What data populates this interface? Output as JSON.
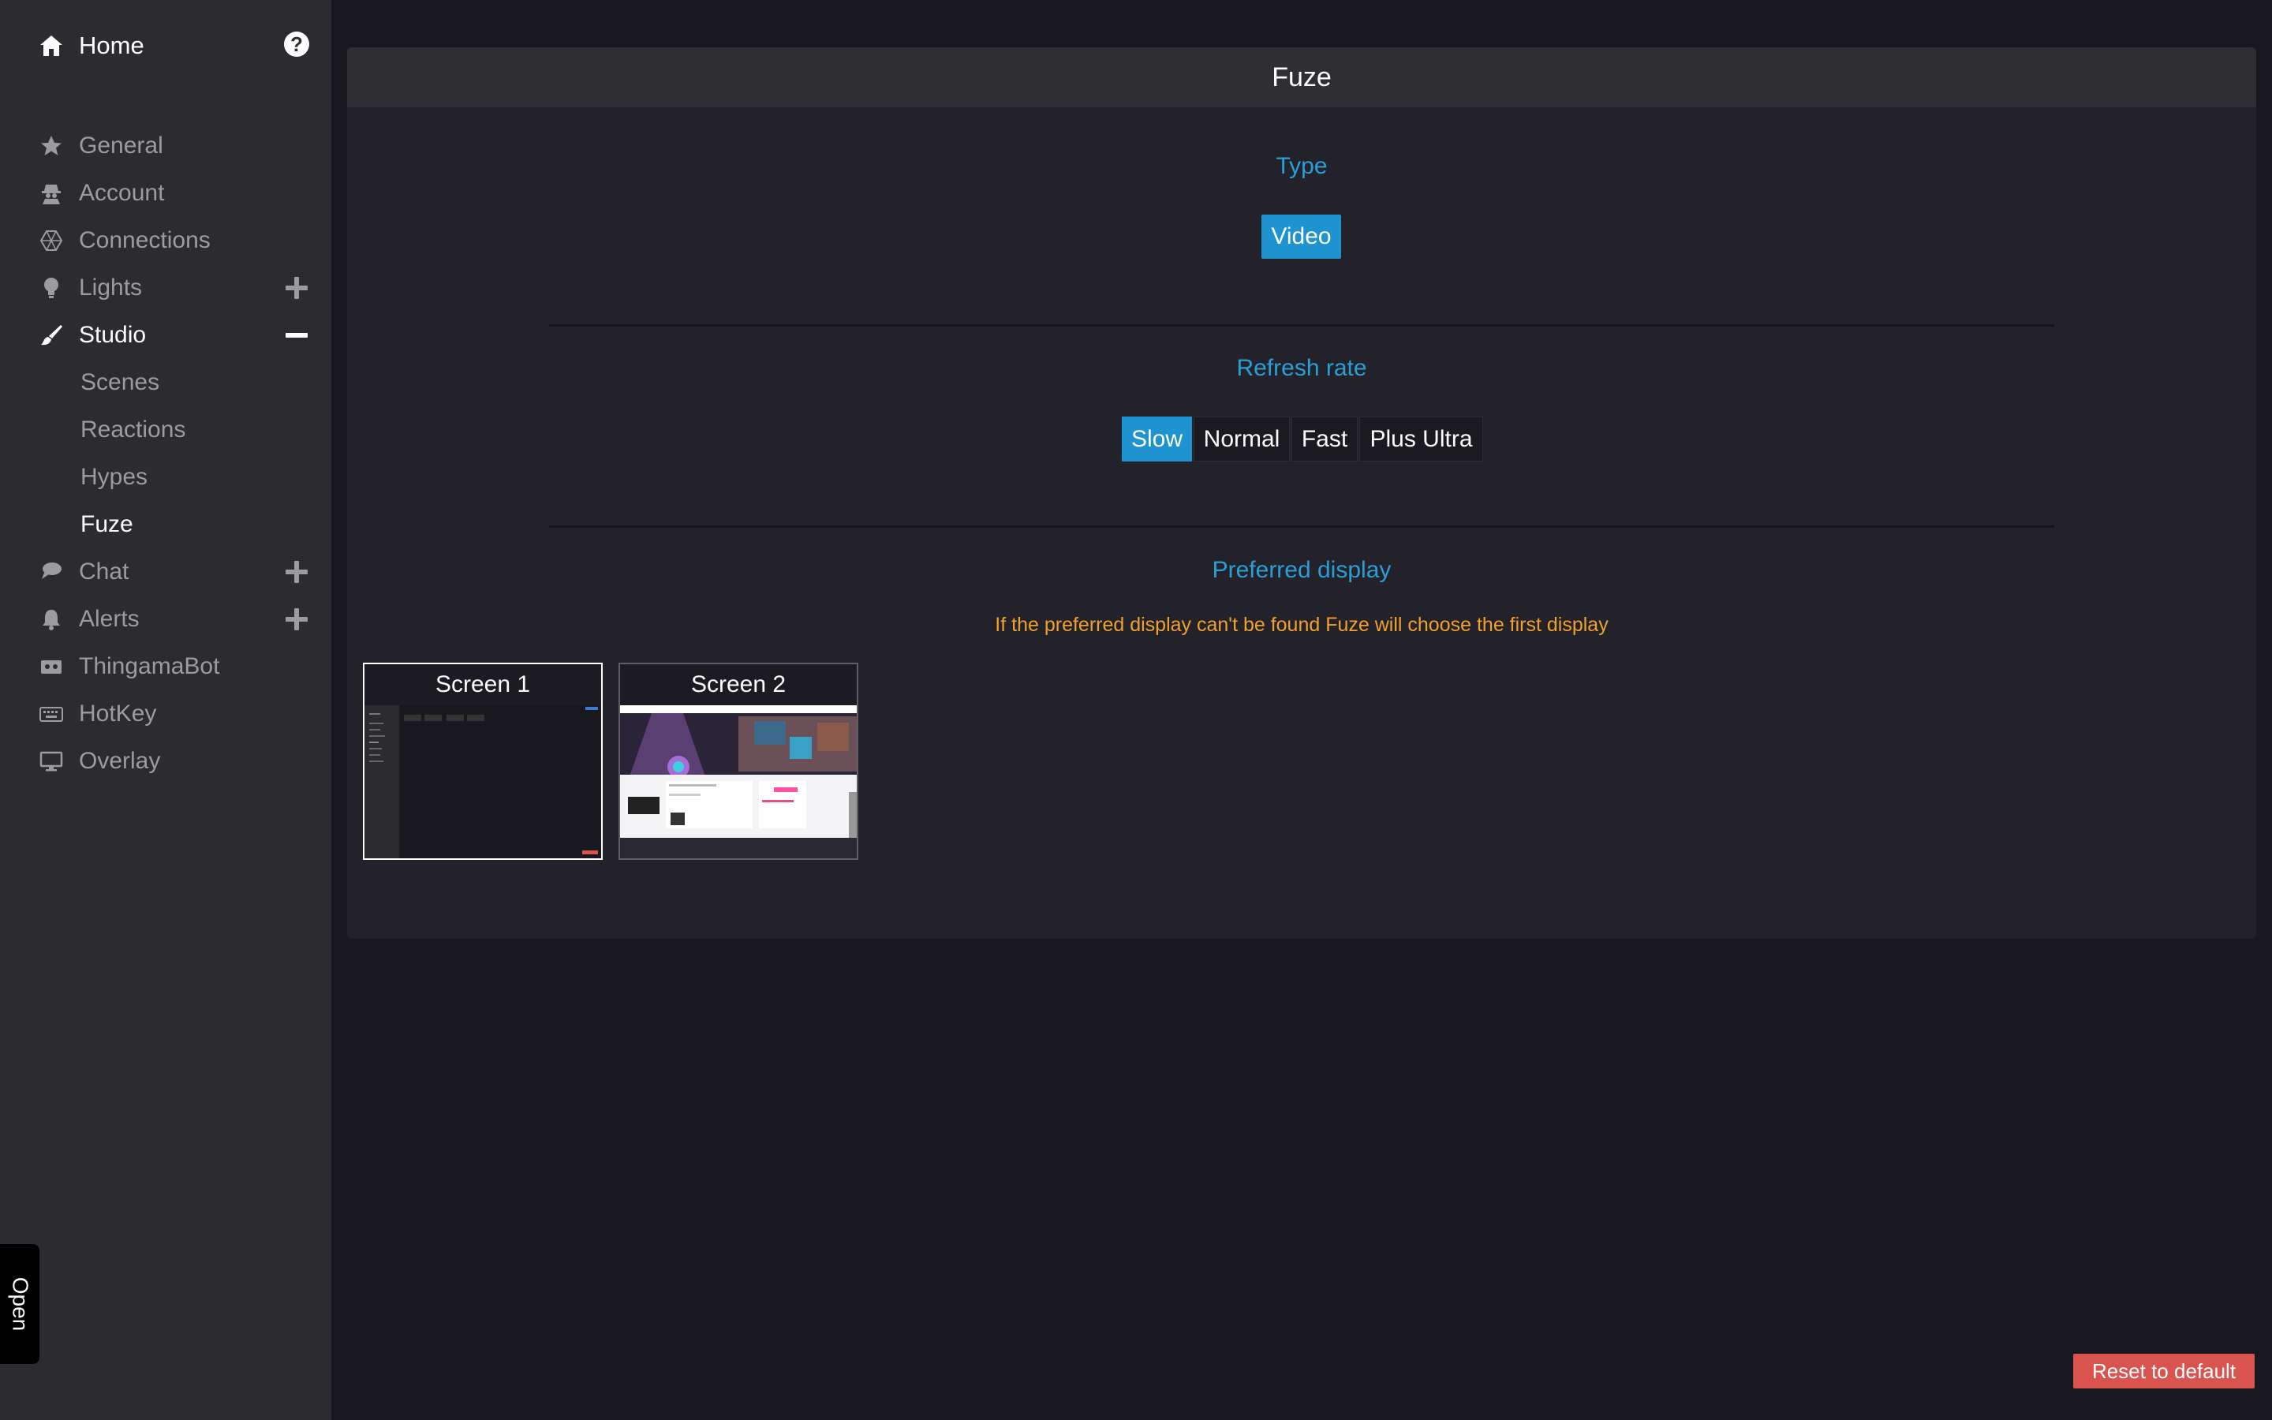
{
  "sidebar": {
    "home": {
      "label": "Home",
      "icon": "home-icon"
    },
    "help_icon": "?",
    "items": [
      {
        "label": "General",
        "icon": "star-icon"
      },
      {
        "label": "Account",
        "icon": "user-secret-icon"
      },
      {
        "label": "Connections",
        "icon": "connections-icon"
      },
      {
        "label": "Lights",
        "icon": "lightbulb-icon",
        "expand": "plus"
      },
      {
        "label": "Studio",
        "icon": "paintbrush-icon",
        "expand": "minus",
        "active": true
      },
      {
        "label": "Chat",
        "icon": "chat-icon",
        "expand": "plus"
      },
      {
        "label": "Alerts",
        "icon": "bell-icon",
        "expand": "plus"
      },
      {
        "label": "ThingamaBot",
        "icon": "robot-icon"
      },
      {
        "label": "HotKey",
        "icon": "keyboard-icon"
      },
      {
        "label": "Overlay",
        "icon": "desktop-icon"
      }
    ],
    "studio_subitems": [
      "Scenes",
      "Reactions",
      "Hypes",
      "Fuze"
    ],
    "active_subitem": "Fuze"
  },
  "open_tab": "Open",
  "panel": {
    "title": "Fuze",
    "type": {
      "title": "Type",
      "selected": "Video"
    },
    "refresh_rate": {
      "title": "Refresh rate",
      "options": [
        "Slow",
        "Normal",
        "Fast",
        "Plus Ultra"
      ],
      "selected": "Slow"
    },
    "preferred_display": {
      "title": "Preferred display",
      "warning": "If the preferred display can't be found Fuze will choose the first display",
      "screens": [
        {
          "label": "Screen 1",
          "selected": true
        },
        {
          "label": "Screen 2",
          "selected": false
        }
      ]
    }
  },
  "reset_button": "Reset to default",
  "colors": {
    "accent": "#2a9fd6",
    "button_selected": "#1e93d0",
    "warning": "#f0a030",
    "danger": "#d9534f",
    "sidebar_bg": "#2b2b30",
    "page_bg": "#19181e"
  }
}
